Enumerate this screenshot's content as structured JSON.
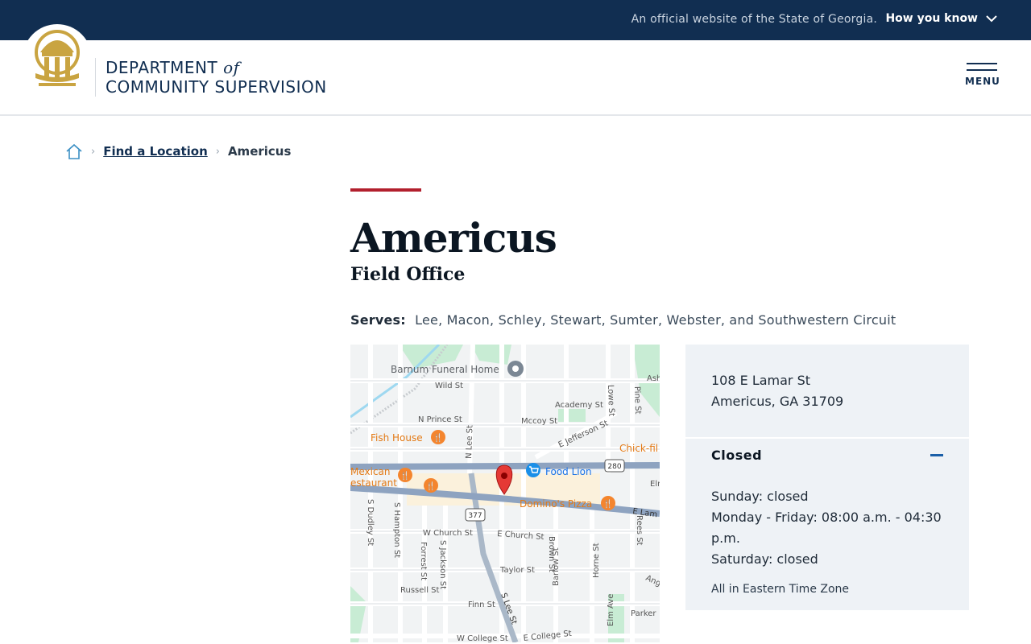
{
  "topbar": {
    "official_text": "An official website of the State of Georgia.",
    "how_you_know": "How you know"
  },
  "header": {
    "dept_line1": "DEPARTMENT",
    "dept_of": "of",
    "dept_line2": "COMMUNITY SUPERVISION",
    "menu_label": "MENU"
  },
  "breadcrumb": {
    "home_icon": "home-icon",
    "items": [
      "Find a Location",
      "Americus"
    ]
  },
  "page": {
    "title": "Americus",
    "subtitle": "Field Office",
    "serves_label": "Serves:",
    "serves_value": "Lee, Macon, Schley, Stewart, Sumter, Webster, and Southwestern Circuit"
  },
  "map": {
    "labels": {
      "barnum": "Barnum Funeral Home",
      "fish_house": "Fish House",
      "mexican1": "Mexican",
      "mexican2": "estaurant",
      "food_lion": "Food Lion",
      "chick": "Chick-fil",
      "dominos": "Domino's Pizza",
      "wild_st": "Wild St",
      "academy": "Academy St",
      "n_prince": "N Prince St",
      "mccoy": "Mccoy St",
      "jefferson": "E Jefferson St",
      "n_lee": "N Lee St",
      "lowe": "Lowe St",
      "pine": "Pine St",
      "ash": "Ash",
      "e_lam": "E Lam",
      "elm_r": "Elm",
      "w_church": "W Church St",
      "e_church": "E Church St",
      "taylor": "Taylor St",
      "russell": "Russell St",
      "finn": "Finn St",
      "w_college": "W College St",
      "e_college": "E College St",
      "parker": "Parker",
      "s_dudley": "S Dudley St",
      "s_hampton": "S Hampton St",
      "forrest": "Forrest St",
      "s_jackson": "S Jackson St",
      "s_lee": "S Lee St",
      "brown": "Brown St",
      "barlow": "Barlow St",
      "horne": "Horne St",
      "elm_ave": "Elm Ave",
      "rees": "Rees St",
      "ang": "Ang",
      "shield_280": "280",
      "shield_377": "377"
    }
  },
  "location": {
    "address_line1": "108 E Lamar St",
    "address_line2": "Americus, GA 31709",
    "status": "Closed",
    "hours": [
      "Sunday: closed",
      "Monday - Friday: 08:00 a.m. - 04:30 p.m.",
      "Saturday: closed"
    ],
    "timezone_note": "All in Eastern Time Zone"
  },
  "colors": {
    "navy": "#112e51",
    "accent_red": "#b21f2d",
    "seal_gold": "#c9a441",
    "info_bg": "#eef2f6"
  }
}
